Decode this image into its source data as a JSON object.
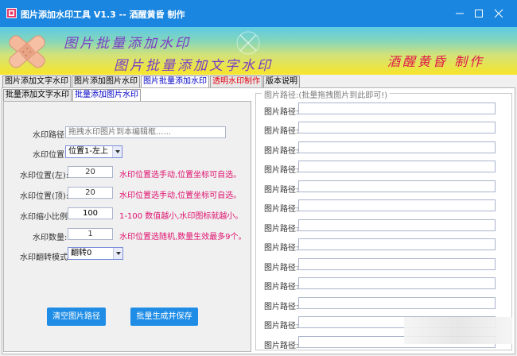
{
  "window": {
    "title": "图片添加水印工具 V1.3 -- 酒醒黄昏 制作",
    "min_icon": "window-minimize",
    "max_icon": "window-maximize",
    "close_icon": "window-close"
  },
  "banner": {
    "line1": "图片批量添加水印",
    "line2": "图片批量添加文字水印",
    "author": "酒醒黄昏 制作",
    "colors": {
      "headline": "#7a3cc6",
      "author": "#e0184a"
    }
  },
  "tabs": [
    {
      "label": "图片添加文字水印"
    },
    {
      "label": "图片添加图片水印"
    },
    {
      "label": "图片批量添加水印"
    },
    {
      "label": "透明水印制作"
    },
    {
      "label": "版本说明"
    }
  ],
  "active_tab": "图片批量添加水印",
  "subtabs": [
    {
      "label": "批量添加文字水印"
    },
    {
      "label": "批量添加图片水印"
    }
  ],
  "active_subtab": "批量添加图片水印",
  "form": {
    "watermark_path_label": "水印路径:",
    "watermark_path_placeholder": "拖拽水印图片到本编辑框......",
    "position_label": "水印位置:",
    "position_value": "位置1-左上",
    "pos_left_label": "水印位置(左):",
    "pos_left_value": "20",
    "pos_left_hint": "水印位置选手动,位置坐标可自选。",
    "pos_top_label": "水印位置(顶):",
    "pos_top_value": "20",
    "pos_top_hint": "水印位置选手动,位置坐标可自选。",
    "scale_label": "水印缩小比例:",
    "scale_value": "100",
    "scale_hint": "1-100 数值越小,水印图标就越小。",
    "count_label": "水印数量:",
    "count_value": "1",
    "count_hint": "水印位置选随机,数量生效最多9个。",
    "flip_label": "水印翻转模式:",
    "flip_value": "翻转0"
  },
  "buttons": {
    "clear": "清空图片路径",
    "generate": "批量生成并保存"
  },
  "paths": {
    "group_title": "图片路径:(批量拖拽图片到此即可!)",
    "labels": [
      "图片路径:",
      "图片路径:",
      "图片路径:",
      "图片路径:",
      "图片路径:",
      "图片路径:",
      "图片路径:",
      "图片路径:",
      "图片路径:",
      "图片路径:",
      "图片路径:",
      "图片路径:",
      "图片路径:",
      "图片路径:"
    ]
  },
  "accent_color": "#1f8de6"
}
